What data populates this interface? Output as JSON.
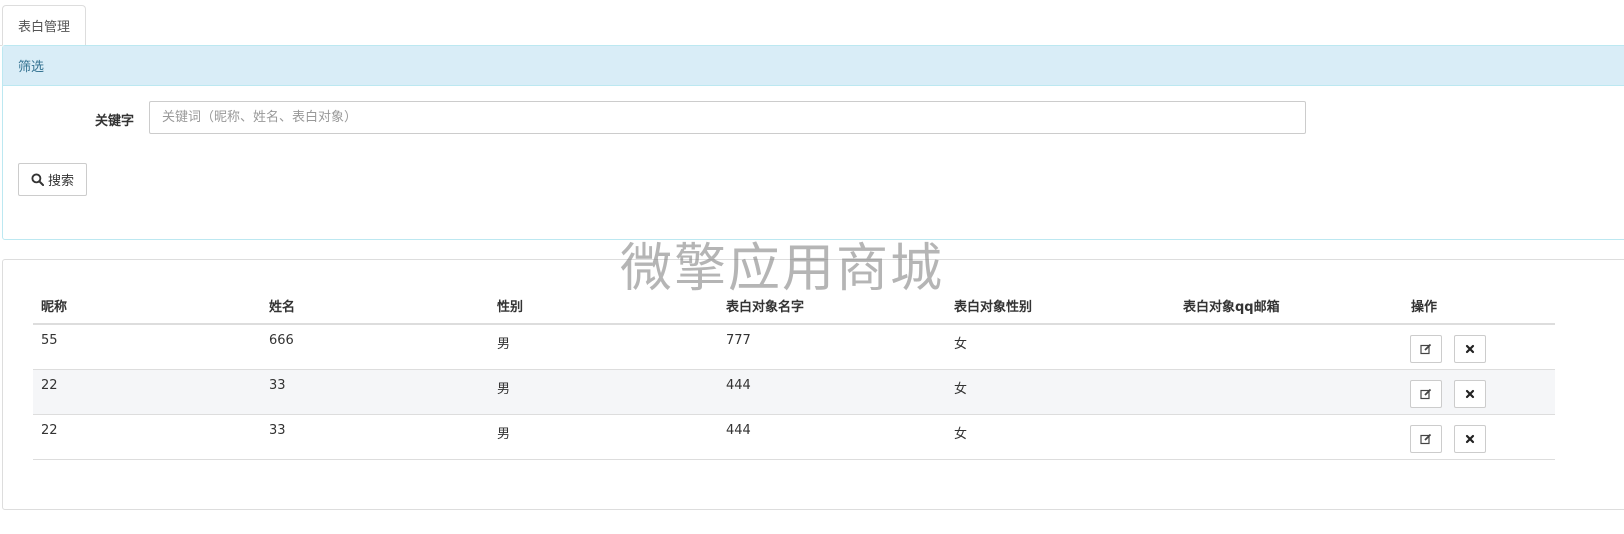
{
  "tabs": [
    {
      "label": "表白管理",
      "active": true
    }
  ],
  "filter": {
    "heading": "筛选",
    "keyword_label": "关键字",
    "keyword_value": "",
    "keyword_placeholder": "关键词（昵称、姓名、表白对象）",
    "search_label": "搜索"
  },
  "watermark": "微擎应用商城",
  "table": {
    "columns": [
      "昵称",
      "姓名",
      "性别",
      "表白对象名字",
      "表白对象性别",
      "表白对象qq邮箱",
      "操作"
    ],
    "rows": [
      [
        "55",
        "666",
        "男",
        "777",
        "女",
        ""
      ],
      [
        "22",
        "33",
        "男",
        "444",
        "女",
        ""
      ],
      [
        "22",
        "33",
        "男",
        "444",
        "女",
        ""
      ]
    ],
    "row_actions": [
      "edit-icon",
      "delete-icon"
    ]
  },
  "colors": {
    "panel_heading_bg": "#d9edf7",
    "panel_heading_text": "#31708f",
    "panel_border": "#bce8f1",
    "row_stripe": "#f5f6f8"
  }
}
